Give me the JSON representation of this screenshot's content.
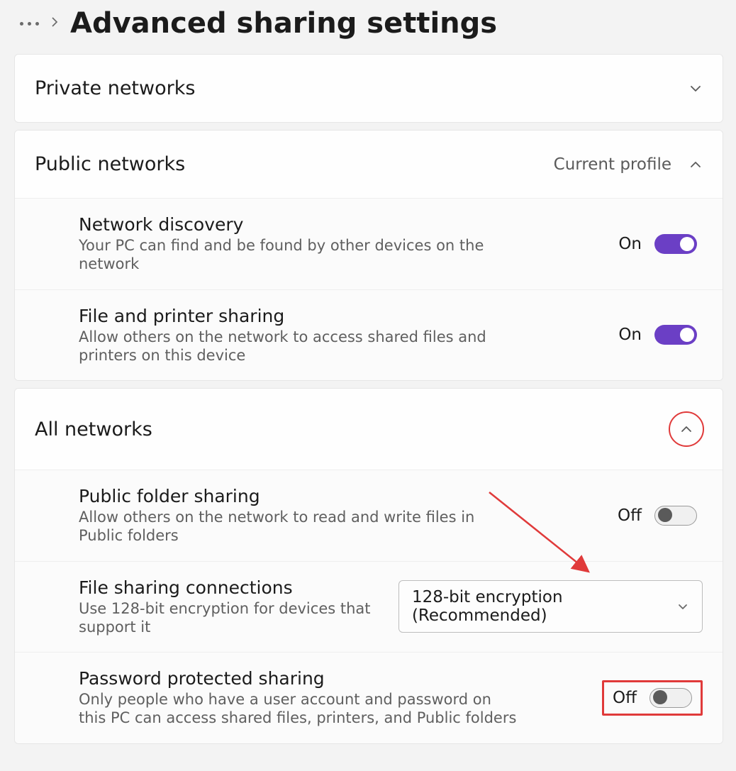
{
  "header": {
    "title": "Advanced sharing settings"
  },
  "sections": {
    "private": {
      "title": "Private networks"
    },
    "public": {
      "title": "Public networks",
      "profile_label": "Current profile",
      "network_discovery": {
        "title": "Network discovery",
        "desc": "Your PC can find and be found by other devices on the network",
        "state_label": "On"
      },
      "file_printer": {
        "title": "File and printer sharing",
        "desc": "Allow others on the network to access shared files and printers on this device",
        "state_label": "On"
      }
    },
    "all": {
      "title": "All networks",
      "public_folder": {
        "title": "Public folder sharing",
        "desc": "Allow others on the network to read and write files in Public folders",
        "state_label": "Off"
      },
      "file_conn": {
        "title": "File sharing connections",
        "desc": "Use 128-bit encryption for devices that support it",
        "selected": "128-bit encryption (Recommended)"
      },
      "password": {
        "title": "Password protected sharing",
        "desc": "Only people who have a user account and password on this PC can access shared files, printers, and Public folders",
        "state_label": "Off"
      }
    }
  }
}
